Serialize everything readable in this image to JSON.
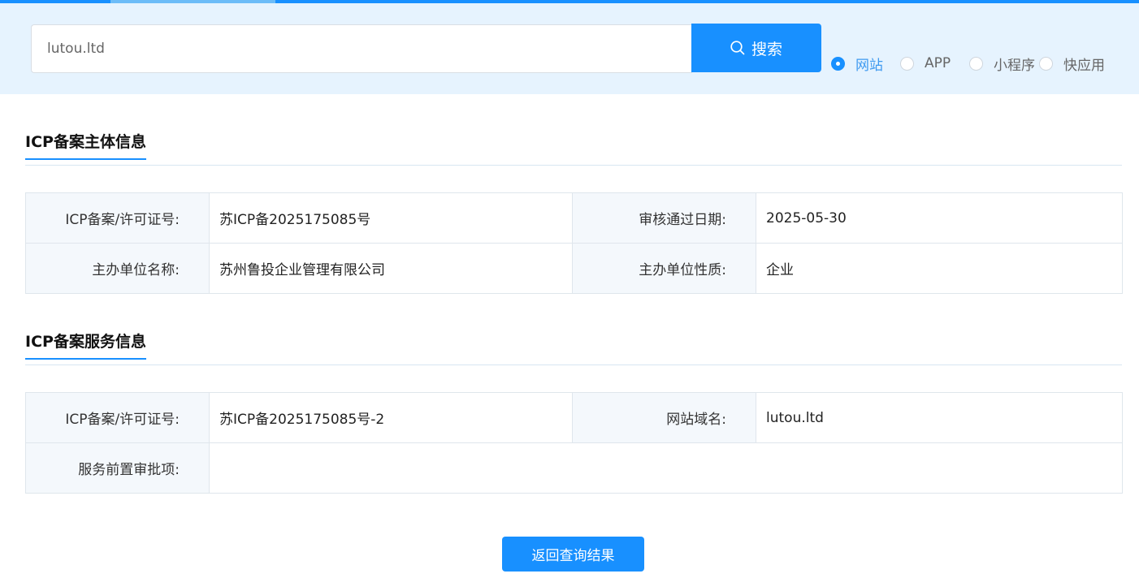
{
  "search": {
    "value": "lutou.ltd",
    "button_label": "搜索",
    "options": [
      {
        "label": "网站",
        "checked": true
      },
      {
        "label": "APP",
        "checked": false
      },
      {
        "label": "小程序",
        "checked": false
      },
      {
        "label": "快应用",
        "checked": false
      }
    ]
  },
  "subject": {
    "title": "ICP备案主体信息",
    "rows": [
      [
        {
          "label": "ICP备案/许可证号:",
          "value": "苏ICP备2025175085号"
        },
        {
          "label": "审核通过日期:",
          "value": "2025-05-30"
        }
      ],
      [
        {
          "label": "主办单位名称:",
          "value": "苏州鲁投企业管理有限公司"
        },
        {
          "label": "主办单位性质:",
          "value": "企业"
        }
      ]
    ]
  },
  "service": {
    "title": "ICP备案服务信息",
    "rows": [
      [
        {
          "label": "ICP备案/许可证号:",
          "value": "苏ICP备2025175085号-2"
        },
        {
          "label": "网站域名:",
          "value": "lutou.ltd"
        }
      ],
      [
        {
          "label": "服务前置审批项:",
          "value": ""
        }
      ]
    ]
  },
  "actions": {
    "back_label": "返回查询结果"
  },
  "colors": {
    "accent": "#1890ff",
    "band_bg": "#e6f3fe",
    "label_cell_bg": "#f4f8fc"
  },
  "icons": {
    "search_button": "search-icon",
    "radio": "radio-dot-icon"
  }
}
